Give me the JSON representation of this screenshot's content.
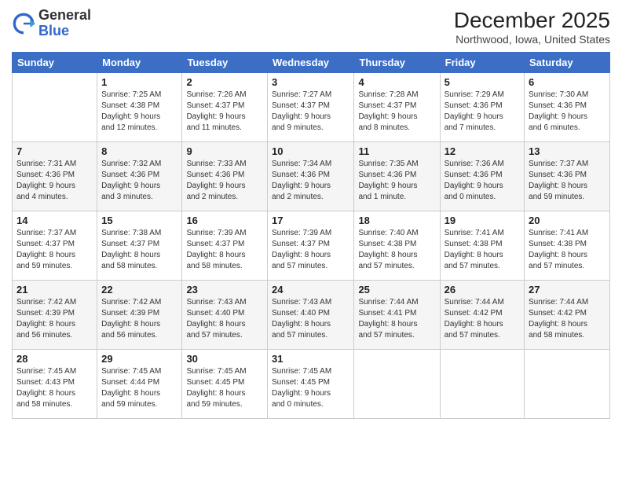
{
  "header": {
    "logo_general": "General",
    "logo_blue": "Blue",
    "month_title": "December 2025",
    "location": "Northwood, Iowa, United States"
  },
  "days_of_week": [
    "Sunday",
    "Monday",
    "Tuesday",
    "Wednesday",
    "Thursday",
    "Friday",
    "Saturday"
  ],
  "weeks": [
    [
      {
        "day": "",
        "info": ""
      },
      {
        "day": "1",
        "info": "Sunrise: 7:25 AM\nSunset: 4:38 PM\nDaylight: 9 hours\nand 12 minutes."
      },
      {
        "day": "2",
        "info": "Sunrise: 7:26 AM\nSunset: 4:37 PM\nDaylight: 9 hours\nand 11 minutes."
      },
      {
        "day": "3",
        "info": "Sunrise: 7:27 AM\nSunset: 4:37 PM\nDaylight: 9 hours\nand 9 minutes."
      },
      {
        "day": "4",
        "info": "Sunrise: 7:28 AM\nSunset: 4:37 PM\nDaylight: 9 hours\nand 8 minutes."
      },
      {
        "day": "5",
        "info": "Sunrise: 7:29 AM\nSunset: 4:36 PM\nDaylight: 9 hours\nand 7 minutes."
      },
      {
        "day": "6",
        "info": "Sunrise: 7:30 AM\nSunset: 4:36 PM\nDaylight: 9 hours\nand 6 minutes."
      }
    ],
    [
      {
        "day": "7",
        "info": "Sunrise: 7:31 AM\nSunset: 4:36 PM\nDaylight: 9 hours\nand 4 minutes."
      },
      {
        "day": "8",
        "info": "Sunrise: 7:32 AM\nSunset: 4:36 PM\nDaylight: 9 hours\nand 3 minutes."
      },
      {
        "day": "9",
        "info": "Sunrise: 7:33 AM\nSunset: 4:36 PM\nDaylight: 9 hours\nand 2 minutes."
      },
      {
        "day": "10",
        "info": "Sunrise: 7:34 AM\nSunset: 4:36 PM\nDaylight: 9 hours\nand 2 minutes."
      },
      {
        "day": "11",
        "info": "Sunrise: 7:35 AM\nSunset: 4:36 PM\nDaylight: 9 hours\nand 1 minute."
      },
      {
        "day": "12",
        "info": "Sunrise: 7:36 AM\nSunset: 4:36 PM\nDaylight: 9 hours\nand 0 minutes."
      },
      {
        "day": "13",
        "info": "Sunrise: 7:37 AM\nSunset: 4:36 PM\nDaylight: 8 hours\nand 59 minutes."
      }
    ],
    [
      {
        "day": "14",
        "info": "Sunrise: 7:37 AM\nSunset: 4:37 PM\nDaylight: 8 hours\nand 59 minutes."
      },
      {
        "day": "15",
        "info": "Sunrise: 7:38 AM\nSunset: 4:37 PM\nDaylight: 8 hours\nand 58 minutes."
      },
      {
        "day": "16",
        "info": "Sunrise: 7:39 AM\nSunset: 4:37 PM\nDaylight: 8 hours\nand 58 minutes."
      },
      {
        "day": "17",
        "info": "Sunrise: 7:39 AM\nSunset: 4:37 PM\nDaylight: 8 hours\nand 57 minutes."
      },
      {
        "day": "18",
        "info": "Sunrise: 7:40 AM\nSunset: 4:38 PM\nDaylight: 8 hours\nand 57 minutes."
      },
      {
        "day": "19",
        "info": "Sunrise: 7:41 AM\nSunset: 4:38 PM\nDaylight: 8 hours\nand 57 minutes."
      },
      {
        "day": "20",
        "info": "Sunrise: 7:41 AM\nSunset: 4:38 PM\nDaylight: 8 hours\nand 57 minutes."
      }
    ],
    [
      {
        "day": "21",
        "info": "Sunrise: 7:42 AM\nSunset: 4:39 PM\nDaylight: 8 hours\nand 56 minutes."
      },
      {
        "day": "22",
        "info": "Sunrise: 7:42 AM\nSunset: 4:39 PM\nDaylight: 8 hours\nand 56 minutes."
      },
      {
        "day": "23",
        "info": "Sunrise: 7:43 AM\nSunset: 4:40 PM\nDaylight: 8 hours\nand 57 minutes."
      },
      {
        "day": "24",
        "info": "Sunrise: 7:43 AM\nSunset: 4:40 PM\nDaylight: 8 hours\nand 57 minutes."
      },
      {
        "day": "25",
        "info": "Sunrise: 7:44 AM\nSunset: 4:41 PM\nDaylight: 8 hours\nand 57 minutes."
      },
      {
        "day": "26",
        "info": "Sunrise: 7:44 AM\nSunset: 4:42 PM\nDaylight: 8 hours\nand 57 minutes."
      },
      {
        "day": "27",
        "info": "Sunrise: 7:44 AM\nSunset: 4:42 PM\nDaylight: 8 hours\nand 58 minutes."
      }
    ],
    [
      {
        "day": "28",
        "info": "Sunrise: 7:45 AM\nSunset: 4:43 PM\nDaylight: 8 hours\nand 58 minutes."
      },
      {
        "day": "29",
        "info": "Sunrise: 7:45 AM\nSunset: 4:44 PM\nDaylight: 8 hours\nand 59 minutes."
      },
      {
        "day": "30",
        "info": "Sunrise: 7:45 AM\nSunset: 4:45 PM\nDaylight: 8 hours\nand 59 minutes."
      },
      {
        "day": "31",
        "info": "Sunrise: 7:45 AM\nSunset: 4:45 PM\nDaylight: 9 hours\nand 0 minutes."
      },
      {
        "day": "",
        "info": ""
      },
      {
        "day": "",
        "info": ""
      },
      {
        "day": "",
        "info": ""
      }
    ]
  ]
}
